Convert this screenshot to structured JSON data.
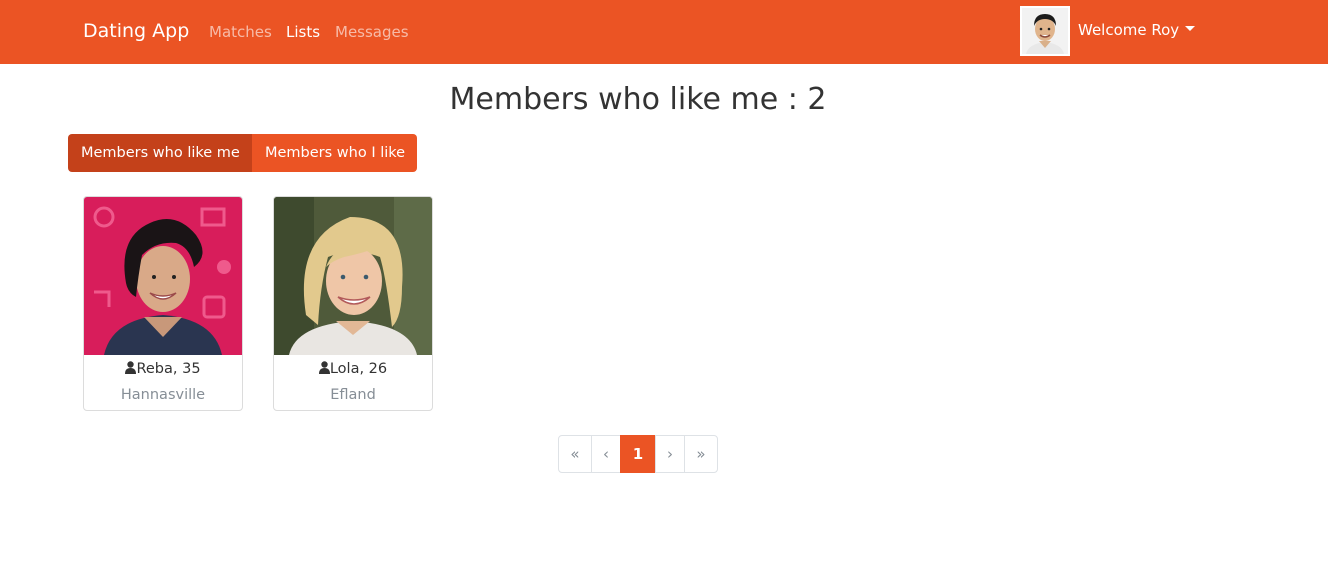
{
  "navbar": {
    "brand": "Dating App",
    "links": [
      {
        "label": "Matches",
        "active": false
      },
      {
        "label": "Lists",
        "active": true
      },
      {
        "label": "Messages",
        "active": false
      }
    ],
    "welcome": "Welcome Roy",
    "accent_color": "#eb5424"
  },
  "page": {
    "title": "Members who like me : 2"
  },
  "tabs": [
    {
      "label": "Members who like me",
      "selected": true
    },
    {
      "label": "Members who I like",
      "selected": false
    }
  ],
  "members": [
    {
      "name_age": "Reba, 35",
      "city": "Hannasville"
    },
    {
      "name_age": "Lola, 26",
      "city": "Efland"
    }
  ],
  "pagination": {
    "first": "«",
    "prev": "‹",
    "current": "1",
    "next": "›",
    "last": "»"
  }
}
